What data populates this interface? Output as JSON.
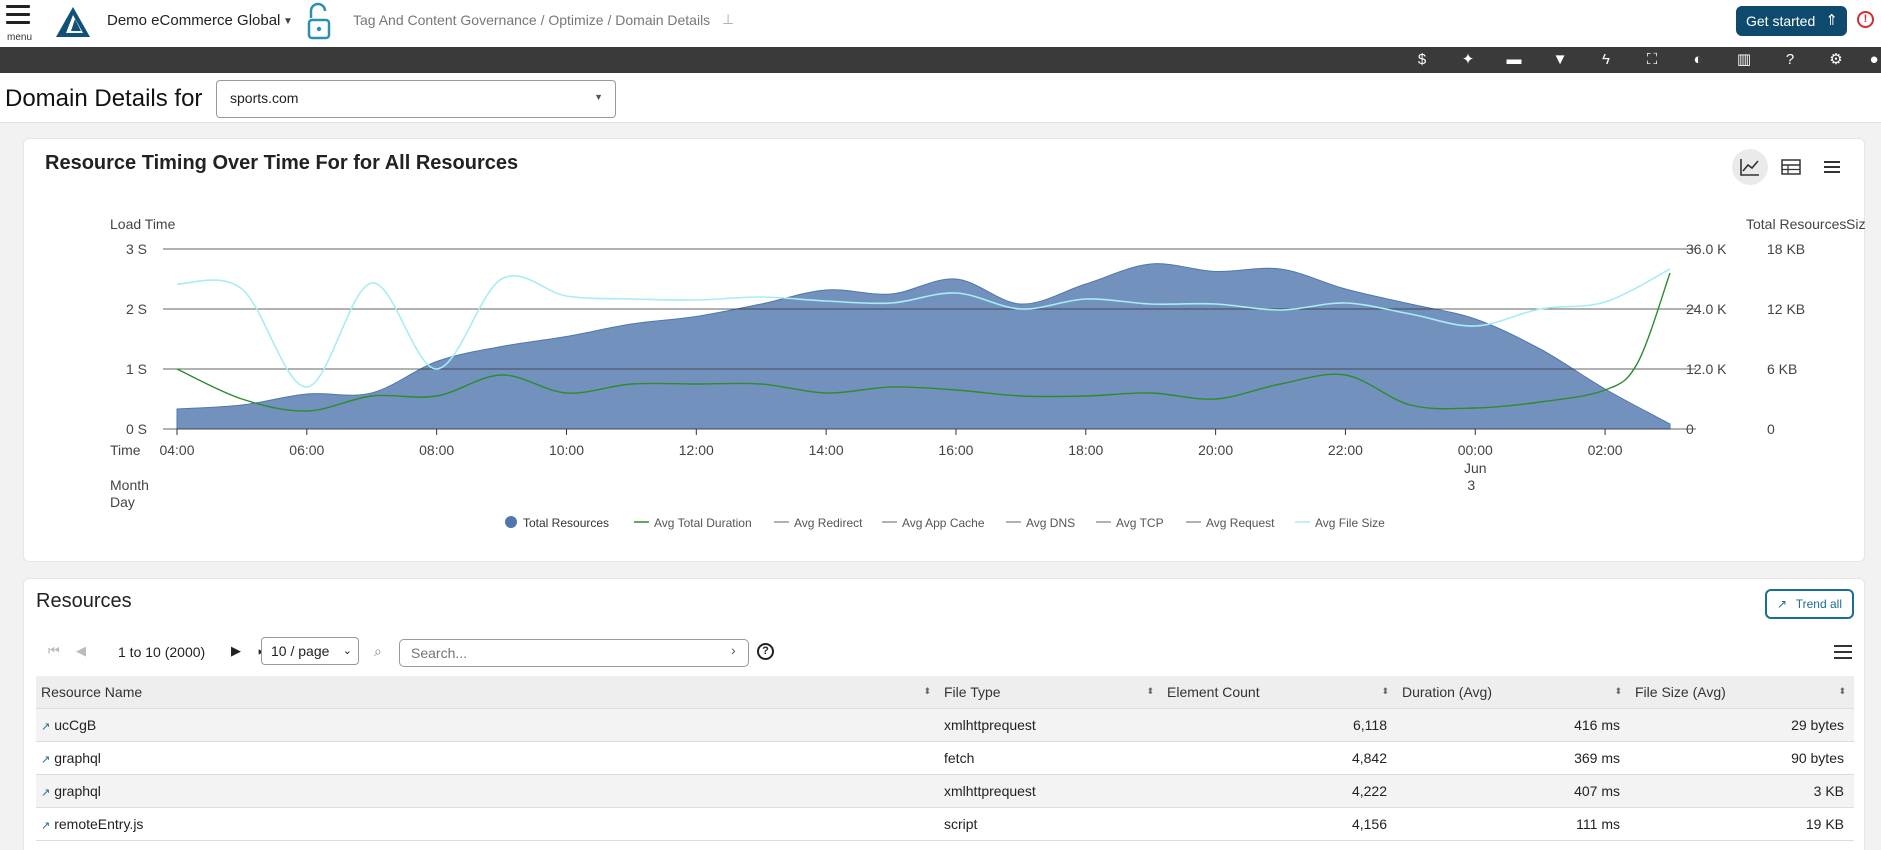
{
  "header": {
    "menu_label": "menu",
    "org_name": "Demo eCommerce Global",
    "breadcrumb": "Tag And Content Governance / Optimize / Domain Details",
    "get_started": "Get started"
  },
  "toolbar": {
    "icons": [
      "dollar-icon",
      "sparkle-icon",
      "chat-icon",
      "filter-icon",
      "lightning-icon",
      "fullscreen-icon",
      "contrast-icon",
      "columns-icon",
      "help-icon",
      "gear-icon",
      "user-icon"
    ]
  },
  "domain": {
    "title": "Domain Details for",
    "selected": "sports.com"
  },
  "chart_panel": {
    "title": "Resource Timing Over Time For for All Resources"
  },
  "chart_data": {
    "type": "area",
    "title": "Resource Timing Over Time For for All Resources",
    "y_left_label": "Load Time",
    "y_left_ticks": [
      "0 S",
      "1 S",
      "2 S",
      "3 S"
    ],
    "y_left_range": [
      0,
      3
    ],
    "y_right1_label": "Total Resources",
    "y_right1_ticks": [
      "0",
      "12.0 K",
      "24.0 K",
      "36.0 K"
    ],
    "y_right1_range": [
      0,
      36000
    ],
    "y_right2_label": "Size",
    "y_right2_ticks": [
      "0",
      "6 KB",
      "12 KB",
      "18 KB"
    ],
    "y_right2_range": [
      0,
      18
    ],
    "x_label_time": "Time",
    "x_label_monthday": "Month Day",
    "x_ticks": [
      {
        "h": 4,
        "label": "04:00"
      },
      {
        "h": 6,
        "label": "06:00"
      },
      {
        "h": 8,
        "label": "08:00"
      },
      {
        "h": 10,
        "label": "10:00"
      },
      {
        "h": 12,
        "label": "12:00"
      },
      {
        "h": 14,
        "label": "14:00"
      },
      {
        "h": 16,
        "label": "16:00"
      },
      {
        "h": 18,
        "label": "18:00"
      },
      {
        "h": 20,
        "label": "20:00"
      },
      {
        "h": 22,
        "label": "22:00"
      },
      {
        "h": 24,
        "label": "00:00",
        "month": "Jun",
        "day": "3"
      },
      {
        "h": 26,
        "label": "02:00"
      }
    ],
    "x_range": [
      4,
      27
    ],
    "grid": true,
    "legend_position": "bottom",
    "series": [
      {
        "name": "Total Resources",
        "type": "area",
        "axis": "right1",
        "color": "#4f77ad",
        "x": [
          4,
          5,
          6,
          7,
          8,
          9,
          10,
          11,
          12,
          13,
          14,
          15,
          16,
          17,
          18,
          19,
          20,
          21,
          22,
          23,
          24,
          25,
          26,
          27
        ],
        "values": [
          4000,
          4800,
          7000,
          7200,
          13500,
          16500,
          18500,
          21000,
          22500,
          25000,
          27800,
          27000,
          30000,
          25000,
          29000,
          33000,
          31500,
          32000,
          28000,
          25000,
          22000,
          16000,
          8000,
          1000
        ]
      },
      {
        "name": "Avg Total Duration",
        "type": "line",
        "axis": "left",
        "color": "#2e8b2e",
        "x": [
          4,
          5,
          6,
          7,
          8,
          9,
          10,
          11,
          12,
          13,
          14,
          15,
          16,
          17,
          18,
          19,
          20,
          21,
          22,
          23,
          24,
          25,
          26,
          26.5,
          27
        ],
        "values": [
          1.0,
          0.5,
          0.3,
          0.55,
          0.55,
          0.9,
          0.6,
          0.75,
          0.75,
          0.75,
          0.6,
          0.7,
          0.65,
          0.55,
          0.55,
          0.6,
          0.5,
          0.75,
          0.9,
          0.4,
          0.35,
          0.45,
          0.65,
          1.1,
          2.6
        ]
      },
      {
        "name": "Avg Redirect",
        "type": "line",
        "axis": "left",
        "color": "#999999",
        "values": []
      },
      {
        "name": "Avg App Cache",
        "type": "line",
        "axis": "left",
        "color": "#999999",
        "values": []
      },
      {
        "name": "Avg DNS",
        "type": "line",
        "axis": "left",
        "color": "#999999",
        "values": []
      },
      {
        "name": "Avg TCP",
        "type": "line",
        "axis": "left",
        "color": "#999999",
        "values": []
      },
      {
        "name": "Avg Request",
        "type": "line",
        "axis": "left",
        "color": "#999999",
        "values": []
      },
      {
        "name": "Avg File Size",
        "type": "line",
        "axis": "right2",
        "color": "#a8ecf5",
        "x": [
          4,
          5,
          6,
          7,
          8,
          9,
          10,
          11,
          12,
          13,
          14,
          15,
          16,
          17,
          18,
          19,
          20,
          21,
          22,
          23,
          24,
          25,
          26,
          27
        ],
        "values": [
          14.5,
          14.0,
          4.2,
          14.6,
          6.0,
          15.0,
          13.3,
          13.0,
          12.9,
          13.2,
          12.8,
          12.6,
          13.6,
          12.0,
          13.0,
          12.5,
          12.5,
          11.9,
          12.6,
          11.5,
          10.3,
          12.0,
          12.7,
          16.0
        ]
      }
    ]
  },
  "resources": {
    "title": "Resources",
    "trend_all": "Trend all",
    "pager_text": "1 to 10 (2000)",
    "per_page": "10 / page",
    "search_placeholder": "Search...",
    "columns": [
      "Resource Name",
      "File Type",
      "Element Count",
      "Duration (Avg)",
      "File Size (Avg)"
    ],
    "rows": [
      [
        "ucCgB",
        "xmlhttprequest",
        "6,118",
        "416 ms",
        "29 bytes"
      ],
      [
        "graphql",
        "fetch",
        "4,842",
        "369 ms",
        "90 bytes"
      ],
      [
        "graphql",
        "xmlhttprequest",
        "4,222",
        "407 ms",
        "3 KB"
      ],
      [
        "remoteEntry.js",
        "script",
        "4,156",
        "111 ms",
        "19 KB"
      ]
    ]
  }
}
